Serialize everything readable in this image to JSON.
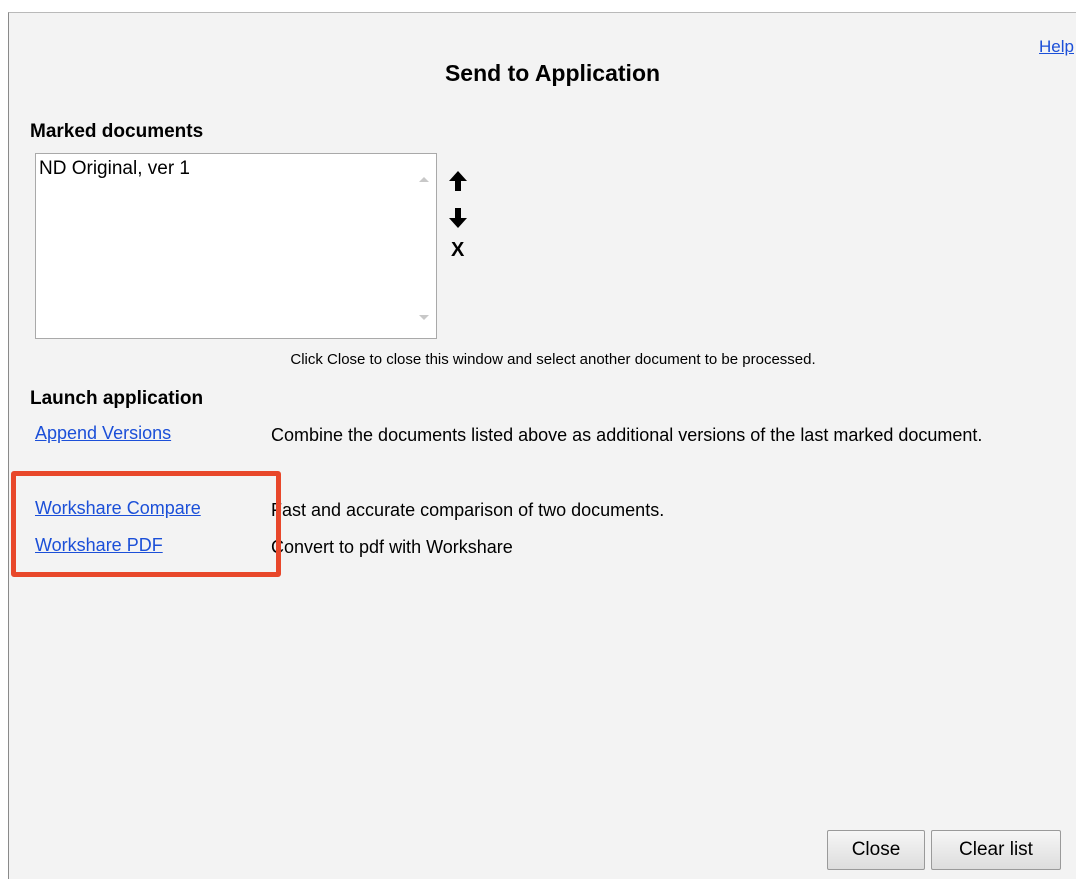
{
  "help_label": "Help",
  "title": "Send to Application",
  "marked_documents": {
    "label": "Marked documents",
    "items": [
      "ND Original, ver 1"
    ],
    "remove_label": "X"
  },
  "hint": "Click Close to close this window and select another document to be processed.",
  "launch": {
    "label": "Launch application",
    "apps": [
      {
        "name": "Append Versions",
        "description": "Combine the documents listed above as additional versions of the last marked document."
      },
      {
        "name": "Workshare Compare",
        "description": "Fast and accurate comparison of two documents."
      },
      {
        "name": "Workshare PDF",
        "description": "Convert to pdf with Workshare"
      }
    ]
  },
  "buttons": {
    "close": "Close",
    "clear_list": "Clear list"
  },
  "colors": {
    "link": "#1b4fd8",
    "highlight": "#e8472a",
    "background": "#f3f3f3"
  },
  "icons": {
    "move_up": "arrow-up-icon",
    "move_down": "arrow-down-icon"
  }
}
